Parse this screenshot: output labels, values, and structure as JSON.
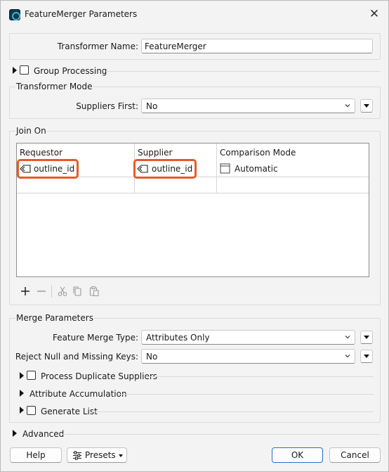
{
  "window": {
    "title": "FeatureMerger Parameters",
    "close_glyph": "✕"
  },
  "transformer_name": {
    "label": "Transformer Name:",
    "value": "FeatureMerger"
  },
  "group_processing": {
    "label": "Group Processing"
  },
  "transformer_mode": {
    "title": "Transformer Mode",
    "suppliers_first_label": "Suppliers First:",
    "suppliers_first_value": "No"
  },
  "join_on": {
    "title": "Join On",
    "columns": [
      "Requestor",
      "Supplier",
      "Comparison Mode"
    ],
    "rows": [
      {
        "requestor": "outline_id",
        "supplier": "outline_id",
        "comparison": "Automatic"
      }
    ]
  },
  "merge_parameters": {
    "title": "Merge Parameters",
    "feature_merge_type_label": "Feature Merge Type:",
    "feature_merge_type_value": "Attributes Only",
    "reject_null_label": "Reject Null and Missing Keys:",
    "reject_null_value": "No",
    "process_duplicate_label": "Process Duplicate Suppliers",
    "attribute_accumulation_label": "Attribute Accumulation",
    "generate_list_label": "Generate List"
  },
  "advanced": {
    "label": "Advanced"
  },
  "buttons": {
    "help": "Help",
    "presets": "Presets",
    "ok": "OK",
    "cancel": "Cancel"
  },
  "colors": {
    "highlight": "#ea5a26",
    "ok_border": "#2a6bd4"
  },
  "icons": {
    "app": "featuremerger-app-icon",
    "attribute": "attribute-tag-icon",
    "add": "plus-icon",
    "remove": "minus-icon",
    "cut": "scissors-icon",
    "copy": "copy-icon",
    "paste": "paste-icon",
    "presets": "sliders-icon"
  }
}
